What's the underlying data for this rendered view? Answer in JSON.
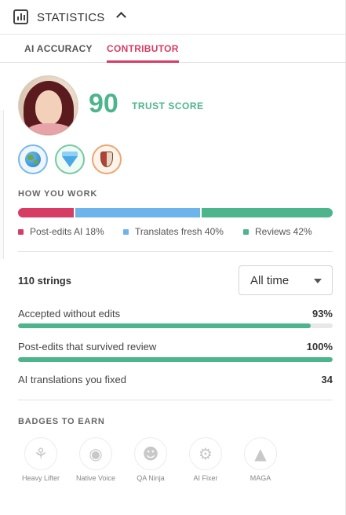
{
  "header": {
    "title": "STATISTICS",
    "icon": "bar-chart-icon",
    "collapse_icon": "chevron-up-icon"
  },
  "tabs": [
    {
      "label": "AI ACCURACY",
      "active": false
    },
    {
      "label": "CONTRIBUTOR",
      "active": true
    }
  ],
  "profile": {
    "trust_score": "90",
    "trust_label": "TRUST SCORE",
    "badges": [
      "globe-badge-icon",
      "diamond-badge-icon",
      "shield-badge-icon"
    ]
  },
  "how_you_work": {
    "title": "HOW YOU WORK",
    "segments": [
      {
        "label": "Post-edits AI 18%",
        "percent": 18,
        "color": "#d63c64"
      },
      {
        "label": "Translates fresh 40%",
        "percent": 40,
        "color": "#6cb4ea"
      },
      {
        "label": "Reviews 42%",
        "percent": 42,
        "color": "#4db58c"
      }
    ]
  },
  "metrics": {
    "strings_count": "110 strings",
    "period_selected": "All time",
    "items": [
      {
        "label": "Accepted without edits",
        "value": "93%",
        "fill": 0.93
      },
      {
        "label": "Post-edits that survived review",
        "value": "100%",
        "fill": 1.0
      },
      {
        "label": "AI translations you fixed",
        "value": "34"
      }
    ]
  },
  "badges_to_earn": {
    "title": "BADGES TO EARN",
    "items": [
      {
        "label": "Heavy Lifter",
        "icon": "weightlifter-icon"
      },
      {
        "label": "Native Voice",
        "icon": "speaking-head-icon"
      },
      {
        "label": "QA Ninja",
        "icon": "ninja-icon"
      },
      {
        "label": "AI Fixer",
        "icon": "robot-icon"
      },
      {
        "label": "MAGA",
        "icon": "cap-icon"
      }
    ]
  },
  "colors": {
    "accent": "#d63c64",
    "success": "#4db58c",
    "info": "#6cb4ea"
  }
}
